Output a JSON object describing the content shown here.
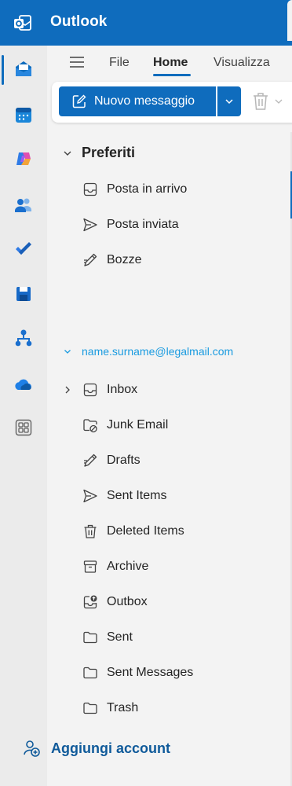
{
  "app": {
    "title": "Outlook"
  },
  "ribbon": {
    "tabs": [
      {
        "label": "File"
      },
      {
        "label": "Home"
      },
      {
        "label": "Visualizza"
      }
    ],
    "active_tab": "Home",
    "new_message_label": "Nuovo messaggio"
  },
  "favorites": {
    "title": "Preferiti",
    "items": [
      {
        "label": "Posta in arrivo",
        "icon": "inbox-icon"
      },
      {
        "label": "Posta inviata",
        "icon": "send-icon"
      },
      {
        "label": "Bozze",
        "icon": "draft-icon"
      }
    ]
  },
  "account": {
    "email": "name.surname@legalmail.com",
    "folders": [
      {
        "label": "Inbox",
        "icon": "inbox-icon"
      },
      {
        "label": "Junk Email",
        "icon": "junk-icon"
      },
      {
        "label": "Drafts",
        "icon": "draft-icon"
      },
      {
        "label": "Sent Items",
        "icon": "send-icon"
      },
      {
        "label": "Deleted Items",
        "icon": "trash-icon"
      },
      {
        "label": "Archive",
        "icon": "archive-icon"
      },
      {
        "label": "Outbox",
        "icon": "outbox-icon"
      },
      {
        "label": "Sent",
        "icon": "folder-icon"
      },
      {
        "label": "Sent Messages",
        "icon": "folder-icon"
      },
      {
        "label": "Trash",
        "icon": "folder-icon"
      }
    ]
  },
  "add_account_label": "Aggiungi account",
  "colors": {
    "brand": "#0f6cbd",
    "account_link": "#1a9be0",
    "add_account": "#0f5a9a"
  }
}
